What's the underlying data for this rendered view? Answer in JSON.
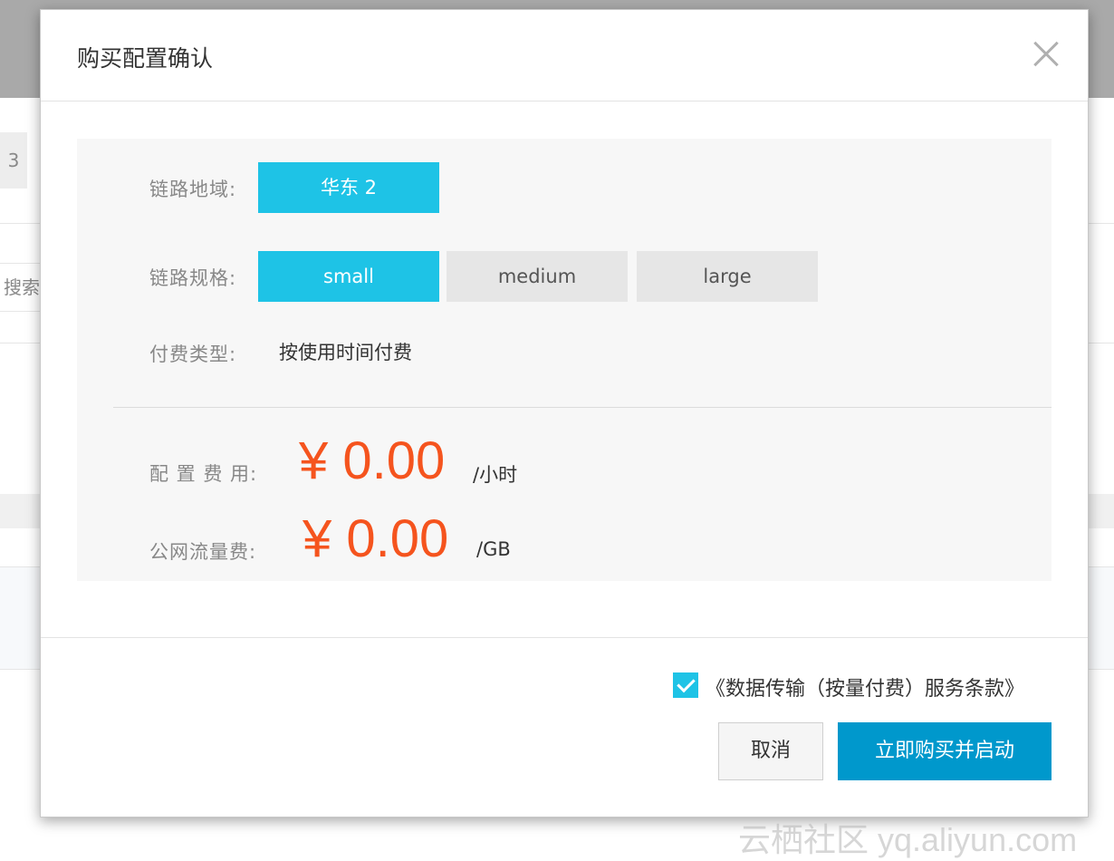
{
  "background": {
    "tab_number": "3",
    "search_text": "搜索"
  },
  "modal": {
    "title": "购买配置确认",
    "close_icon": "close-icon",
    "region": {
      "label": "链路地域:",
      "selected": "华东 2"
    },
    "spec": {
      "label": "链路规格:",
      "options": [
        "small",
        "medium",
        "large"
      ],
      "selected": "small"
    },
    "payment": {
      "label": "付费类型:",
      "value": "按使用时间付费"
    },
    "fees": {
      "config_label": "配 置 费 用:",
      "config_price": "¥ 0.00",
      "config_unit": "/小时",
      "traffic_label": "公网流量费:",
      "traffic_price": "¥ 0.00",
      "traffic_unit": "/GB"
    },
    "terms": {
      "checked": true,
      "text": "《数据传输（按量付费）服务条款》"
    },
    "buttons": {
      "cancel": "取消",
      "confirm": "立即购买并启动"
    }
  },
  "watermark": "云栖社区 yq.aliyun.com",
  "colors": {
    "accent": "#1ec3e6",
    "primary_button": "#0098cc",
    "price": "#f5541e"
  }
}
